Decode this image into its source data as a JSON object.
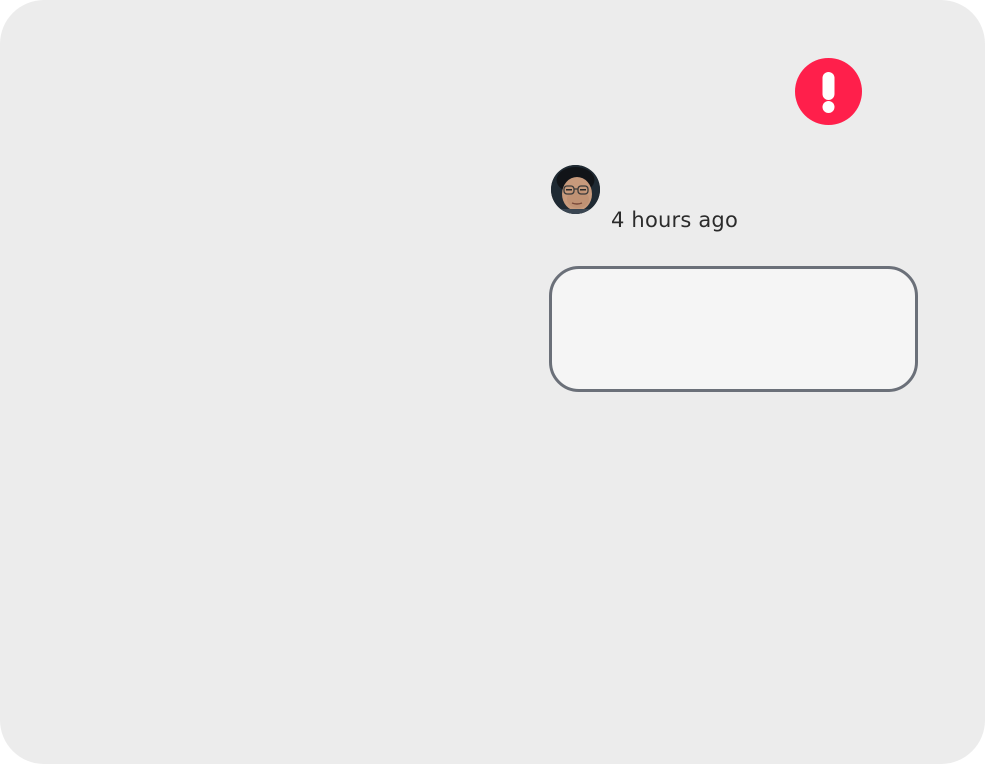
{
  "colors": {
    "background": "#ececec",
    "alert": "#ff1f4b",
    "text": "#2b2b2b",
    "input_border": "#6b7079",
    "input_fill": "#f5f5f5"
  },
  "alert": {
    "icon": "exclamation-icon"
  },
  "user": {
    "avatar": "avatar-photo"
  },
  "comment": {
    "timestamp": "4 hours ago",
    "body": ""
  }
}
